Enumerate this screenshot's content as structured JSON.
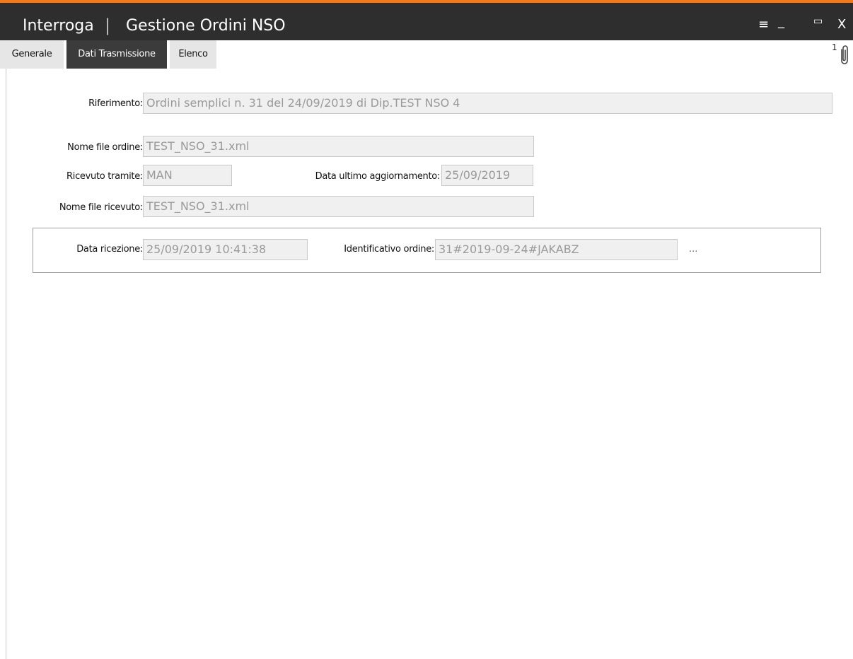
{
  "window": {
    "mode": "Interroga",
    "separator": "|",
    "title": "Gestione Ordini NSO",
    "controls": {
      "menu": "≡",
      "minimize": "_",
      "maximize": "▭",
      "close": "X"
    }
  },
  "tabs": [
    {
      "label": "Generale",
      "active": false
    },
    {
      "label": "Dati Trasmissione",
      "active": true
    },
    {
      "label": "Elenco",
      "active": false
    }
  ],
  "attachments": {
    "count": "1"
  },
  "form": {
    "riferimento": {
      "label": "Riferimento:",
      "value": "Ordini semplici n. 31 del 24/09/2019 di Dip.TEST NSO 4"
    },
    "nome_file_ordine": {
      "label": "Nome file ordine:",
      "value": "TEST_NSO_31.xml"
    },
    "ricevuto_tramite": {
      "label": "Ricevuto tramite:",
      "value": "MAN"
    },
    "data_ultimo_aggiornamento": {
      "label": "Data ultimo aggiornamento:",
      "value": "25/09/2019"
    },
    "nome_file_ricevuto": {
      "label": "Nome file ricevuto:",
      "value": "TEST_NSO_31.xml"
    },
    "data_ricezione": {
      "label": "Data ricezione:",
      "value": "25/09/2019 10:41:38"
    },
    "identificativo_ordine": {
      "label": "Identificativo ordine:",
      "value": "31#2019-09-24#JAKABZ"
    },
    "more_button": "..."
  },
  "colors": {
    "accent": "#f07a1e",
    "titlebar": "#2e2e2e",
    "active_tab": "#3b3b3b",
    "field_bg": "#f0f0f0"
  }
}
